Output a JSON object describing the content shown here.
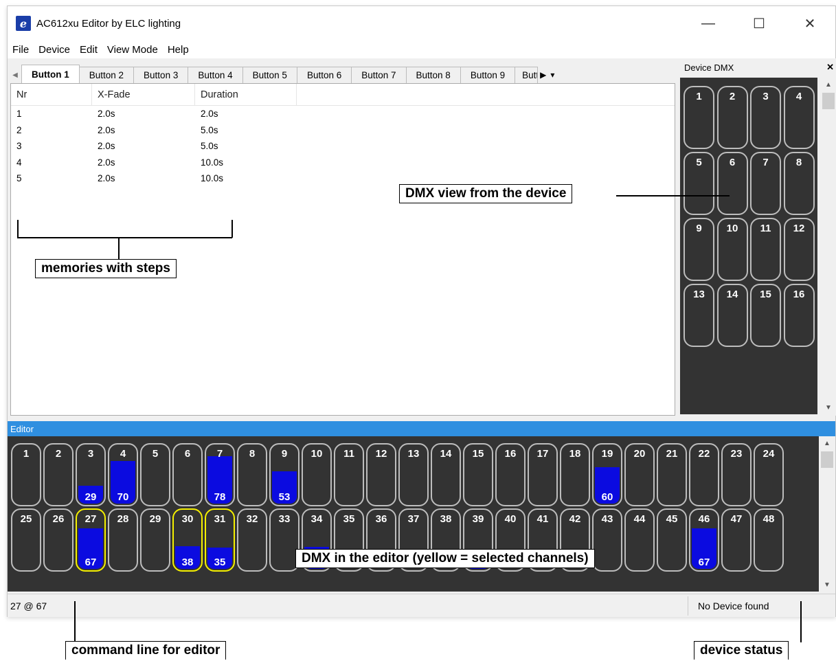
{
  "window": {
    "title": "AC612xu Editor by ELC lighting",
    "icon_glyph": "e",
    "minimize_glyph": "—",
    "maximize_glyph": "☐",
    "close_glyph": "✕"
  },
  "menu": [
    "File",
    "Device",
    "Edit",
    "View Mode",
    "Help"
  ],
  "tabs": {
    "items": [
      "Button 1",
      "Button 2",
      "Button 3",
      "Button 4",
      "Button 5",
      "Button 6",
      "Button 7",
      "Button 8",
      "Button 9",
      "Butt"
    ],
    "active_index": 0,
    "scroll_left_glyph": "◀",
    "scroll_right_glyph": "▶",
    "overflow_glyph": "▾"
  },
  "memory_table": {
    "columns": [
      "Nr",
      "X-Fade",
      "Duration"
    ],
    "rows": [
      [
        "1",
        "2.0s",
        "2.0s"
      ],
      [
        "2",
        "2.0s",
        "5.0s"
      ],
      [
        "3",
        "2.0s",
        "5.0s"
      ],
      [
        "4",
        "2.0s",
        "10.0s"
      ],
      [
        "5",
        "2.0s",
        "10.0s"
      ]
    ]
  },
  "device_panel": {
    "title": "Device DMX",
    "close_glyph": "✕",
    "channels": [
      1,
      2,
      3,
      4,
      5,
      6,
      7,
      8,
      9,
      10,
      11,
      12,
      13,
      14,
      15,
      16
    ]
  },
  "editor": {
    "title": "Editor",
    "channels": [
      {
        "n": 1
      },
      {
        "n": 2
      },
      {
        "n": 3,
        "v": 29,
        "fill": 0.29
      },
      {
        "n": 4,
        "v": 70,
        "fill": 0.7
      },
      {
        "n": 5
      },
      {
        "n": 6
      },
      {
        "n": 7,
        "v": 78,
        "fill": 0.78
      },
      {
        "n": 8
      },
      {
        "n": 9,
        "v": 53,
        "fill": 0.53
      },
      {
        "n": 10
      },
      {
        "n": 11
      },
      {
        "n": 12
      },
      {
        "n": 13
      },
      {
        "n": 14
      },
      {
        "n": 15
      },
      {
        "n": 16
      },
      {
        "n": 17
      },
      {
        "n": 18
      },
      {
        "n": 19,
        "v": 60,
        "fill": 0.6
      },
      {
        "n": 20
      },
      {
        "n": 21
      },
      {
        "n": 22
      },
      {
        "n": 23
      },
      {
        "n": 24
      },
      {
        "n": 25
      },
      {
        "n": 26
      },
      {
        "n": 27,
        "v": 67,
        "fill": 0.67,
        "sel": true
      },
      {
        "n": 28
      },
      {
        "n": 29
      },
      {
        "n": 30,
        "v": 38,
        "fill": 0.38,
        "sel": true
      },
      {
        "n": 31,
        "v": 35,
        "fill": 0.35,
        "sel": true
      },
      {
        "n": 32
      },
      {
        "n": 33
      },
      {
        "n": 34,
        "v": 36,
        "fill": 0.36
      },
      {
        "n": 35
      },
      {
        "n": 36
      },
      {
        "n": 37
      },
      {
        "n": 38
      },
      {
        "n": 39,
        "v": 32,
        "fill": 0.32
      },
      {
        "n": 40
      },
      {
        "n": 41
      },
      {
        "n": 42
      },
      {
        "n": 43
      },
      {
        "n": 44
      },
      {
        "n": 45
      },
      {
        "n": 46,
        "v": 67,
        "fill": 0.67
      },
      {
        "n": 47
      },
      {
        "n": 48
      }
    ]
  },
  "status": {
    "command": "27 @ 67",
    "device": "No Device found"
  },
  "annotations": {
    "memories": "memories with steps",
    "dmx_device": "DMX view from the device",
    "dmx_editor": "DMX in the editor (yellow = selected channels)",
    "command_line": "command line for editor",
    "device_status": "device status"
  },
  "colors": {
    "fill": "#0b0be0",
    "selected_border": "#f5f000",
    "editor_bar": "#2f8fe0",
    "panel_bg": "#333333"
  }
}
